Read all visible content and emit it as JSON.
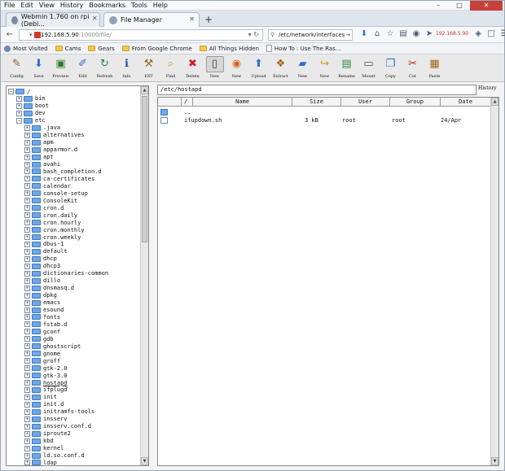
{
  "menu": [
    "File",
    "Edit",
    "View",
    "History",
    "Bookmarks",
    "Tools",
    "Help"
  ],
  "tabs": [
    {
      "label": "Webmin 1.760 on rpi (Debi...",
      "active": false
    },
    {
      "label": "File Manager",
      "active": true
    }
  ],
  "nav": {
    "url_host": "192.168.5.90",
    "url_path": ":10000/file/",
    "search_value": "/etc/network/interfaces",
    "ip_label": "192.168.5.90"
  },
  "bookmarks": [
    "Most Visited",
    "Cams",
    "Gears",
    "From Google Chrome",
    "All Things Hidden",
    "How To : Use The Ras..."
  ],
  "toolbar": [
    {
      "label": "Config",
      "icon": "tools-icon",
      "glyph": "✎",
      "color": "#8b5a2b"
    },
    {
      "label": "Save",
      "icon": "download-arrow-icon",
      "glyph": "⬇",
      "color": "#2e6fd1"
    },
    {
      "label": "Preview",
      "icon": "preview-monitor-icon",
      "glyph": "▣",
      "color": "#2a7a2a"
    },
    {
      "label": "Edit",
      "icon": "edit-page-icon",
      "glyph": "✐",
      "color": "#2e6fd1"
    },
    {
      "label": "Refresh",
      "icon": "refresh-icon",
      "glyph": "↻",
      "color": "#1e8a3a"
    },
    {
      "label": "Info",
      "icon": "info-icon",
      "glyph": "ℹ",
      "color": "#1f4fa8"
    },
    {
      "label": "EXT",
      "icon": "hammer-icon",
      "glyph": "⚒",
      "color": "#9a6a2a"
    },
    {
      "label": "Find",
      "icon": "magnifier-icon",
      "glyph": "⌕",
      "color": "#c89a10"
    },
    {
      "label": "Delete",
      "icon": "delete-x-icon",
      "glyph": "✖",
      "color": "#cc2222"
    },
    {
      "label": "New",
      "icon": "new-file-icon",
      "glyph": "▯",
      "color": "#3a3a3a"
    },
    {
      "label": "New",
      "icon": "browser-globe-icon",
      "glyph": "◉",
      "color": "#d9641e"
    },
    {
      "label": "Upload",
      "icon": "upload-arrow-icon",
      "glyph": "⬆",
      "color": "#2e6fd1"
    },
    {
      "label": "Extract",
      "icon": "extract-box-icon",
      "glyph": "❖",
      "color": "#a0641e"
    },
    {
      "label": "New",
      "icon": "new-folder-icon",
      "glyph": "▰",
      "color": "#2e6fd1"
    },
    {
      "label": "New",
      "icon": "new-link-icon",
      "glyph": "↪",
      "color": "#d9941e"
    },
    {
      "label": "Rename",
      "icon": "rename-icon",
      "glyph": "▤",
      "color": "#2a8a3a"
    },
    {
      "label": "Mount",
      "icon": "mount-drive-icon",
      "glyph": "▭",
      "color": "#555555"
    },
    {
      "label": "Copy",
      "icon": "copy-icon",
      "glyph": "❐",
      "color": "#2e6fd1"
    },
    {
      "label": "Cut",
      "icon": "scissors-icon",
      "glyph": "✂",
      "color": "#cc2222"
    },
    {
      "label": "Paste",
      "icon": "paste-icon",
      "glyph": "▦",
      "color": "#a0641e"
    }
  ],
  "tree": {
    "root": "/",
    "top_items": [
      "bin",
      "boot",
      "dev",
      "etc"
    ],
    "etc_children": [
      ".java",
      "alternatives",
      "apm",
      "apparmor.d",
      "apt",
      "avahi",
      "bash_completion.d",
      "ca-certificates",
      "calendar",
      "console-setup",
      "ConsoleKit",
      "cron.d",
      "cron.daily",
      "cron.hourly",
      "cron.monthly",
      "cron.weekly",
      "dbus-1",
      "default",
      "dhcp",
      "dhcp3",
      "dictionaries-common",
      "dillo",
      "dnsmasq.d",
      "dpkg",
      "emacs",
      "esound",
      "fonts",
      "fstab.d",
      "gconf",
      "gdb",
      "ghostscript",
      "gnome",
      "groff",
      "gtk-2.0",
      "gtk-3.0",
      "hostapd",
      "ifplugd",
      "init",
      "init.d",
      "initramfs-tools",
      "insserv",
      "insserv.conf.d",
      "iproute2",
      "kbd",
      "kernel",
      "ld.so.conf.d",
      "ldap"
    ],
    "selected": "hostapd"
  },
  "path": "/etc/hostapd",
  "history_label": "History",
  "table": {
    "headers": [
      "/",
      "Name",
      "Size",
      "User",
      "Group",
      "Date"
    ],
    "rows": [
      {
        "type": "folder",
        "name": "..",
        "size": "",
        "user": "",
        "group": "",
        "date": ""
      },
      {
        "type": "file",
        "name": "ifupdown.sh",
        "size": "3 kB",
        "user": "root",
        "group": "root",
        "date": "24/Apr"
      }
    ]
  }
}
